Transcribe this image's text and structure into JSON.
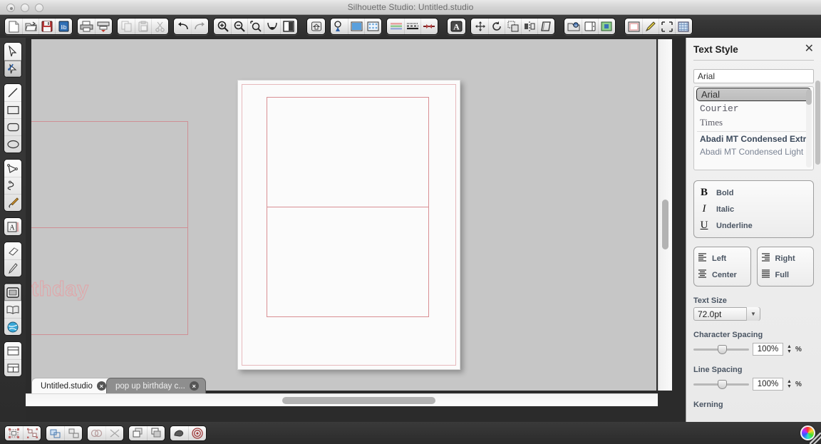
{
  "window": {
    "title": "Silhouette Studio: Untitled.studio",
    "controls": [
      "close",
      "minimize",
      "zoom"
    ]
  },
  "toolbar": {
    "groups": [
      {
        "name": "file",
        "buttons": [
          {
            "label": "New",
            "icon": "new-document-icon"
          },
          {
            "label": "Open",
            "icon": "open-folder-icon"
          },
          {
            "label": "Save",
            "icon": "save-disk-icon"
          },
          {
            "label": "Save to Library",
            "icon": "library-save-icon"
          }
        ]
      },
      {
        "name": "print",
        "buttons": [
          {
            "label": "Print",
            "icon": "printer-icon"
          },
          {
            "label": "Cut / Send",
            "icon": "cutter-icon"
          }
        ]
      },
      {
        "name": "clipboard",
        "buttons": [
          {
            "label": "Copy",
            "icon": "copy-icon"
          },
          {
            "label": "Paste",
            "icon": "paste-icon"
          },
          {
            "label": "Cut",
            "icon": "scissors-icon"
          }
        ]
      },
      {
        "name": "history",
        "buttons": [
          {
            "label": "Undo",
            "icon": "undo-arrow-icon"
          },
          {
            "label": "Redo",
            "icon": "redo-arrow-icon"
          }
        ]
      },
      {
        "name": "zoom",
        "buttons": [
          {
            "label": "Zoom In",
            "icon": "zoom-in-icon"
          },
          {
            "label": "Zoom Out",
            "icon": "zoom-out-icon"
          },
          {
            "label": "Zoom Selection",
            "icon": "zoom-selection-icon"
          },
          {
            "label": "Fit to Page",
            "icon": "fit-page-icon"
          },
          {
            "label": "Fit to Window",
            "icon": "fit-window-icon"
          }
        ]
      },
      {
        "name": "page-setup",
        "buttons": [
          {
            "label": "Page Setup",
            "icon": "house-page-icon"
          }
        ]
      },
      {
        "name": "design",
        "buttons": [
          {
            "label": "Cut Settings",
            "icon": "cut-settings-icon"
          },
          {
            "label": "Page Color",
            "icon": "page-color-icon"
          },
          {
            "label": "Registration Marks",
            "icon": "registration-marks-icon"
          }
        ]
      },
      {
        "name": "style",
        "buttons": [
          {
            "label": "Fill Color",
            "icon": "fill-color-icon"
          },
          {
            "label": "Line Style",
            "icon": "line-style-icon"
          },
          {
            "label": "Line Thickness",
            "icon": "line-thickness-icon"
          }
        ]
      },
      {
        "name": "text",
        "buttons": [
          {
            "label": "Text Style",
            "icon": "text-style-a-icon"
          }
        ]
      },
      {
        "name": "transform",
        "buttons": [
          {
            "label": "Move",
            "icon": "move-arrows-icon"
          },
          {
            "label": "Rotate",
            "icon": "rotate-icon"
          },
          {
            "label": "Scale",
            "icon": "scale-icon"
          },
          {
            "label": "Mirror",
            "icon": "mirror-icon"
          },
          {
            "label": "Shear",
            "icon": "shear-icon"
          }
        ]
      },
      {
        "name": "library",
        "buttons": [
          {
            "label": "My Library",
            "icon": "library-folder-icon"
          },
          {
            "label": "Store",
            "icon": "store-icon"
          },
          {
            "label": "Design Page",
            "icon": "design-page-icon"
          }
        ]
      },
      {
        "name": "view",
        "buttons": [
          {
            "label": "Page View",
            "icon": "page-view-icon"
          },
          {
            "label": "Trace",
            "icon": "pencil-trace-icon"
          },
          {
            "label": "Crop",
            "icon": "crop-icon"
          },
          {
            "label": "Grid",
            "icon": "grid-icon"
          }
        ]
      }
    ]
  },
  "left_tools": {
    "groups": [
      {
        "name": "select",
        "tools": [
          {
            "label": "Select",
            "icon": "cursor-arrow-icon",
            "selected": false
          },
          {
            "label": "Edit Points",
            "icon": "edit-points-icon",
            "selected": true
          }
        ]
      },
      {
        "name": "draw",
        "tools": [
          {
            "label": "Line",
            "icon": "line-icon",
            "selected": false
          },
          {
            "label": "Rectangle",
            "icon": "rectangle-icon",
            "selected": false
          },
          {
            "label": "Rounded Rectangle",
            "icon": "rounded-rectangle-icon",
            "selected": false
          },
          {
            "label": "Ellipse",
            "icon": "ellipse-icon",
            "selected": false
          }
        ]
      },
      {
        "name": "paths",
        "tools": [
          {
            "label": "Polygon",
            "icon": "polygon-icon",
            "selected": false
          },
          {
            "label": "Curve",
            "icon": "curve-icon",
            "selected": false
          },
          {
            "label": "Freehand",
            "icon": "freehand-pencil-icon",
            "selected": false
          }
        ]
      },
      {
        "name": "type",
        "tools": [
          {
            "label": "Text",
            "icon": "text-tool-icon",
            "selected": false
          }
        ]
      },
      {
        "name": "erase",
        "tools": [
          {
            "label": "Eraser",
            "icon": "eraser-icon",
            "selected": false
          },
          {
            "label": "Knife",
            "icon": "knife-icon",
            "selected": false
          }
        ]
      },
      {
        "name": "panels",
        "tools": [
          {
            "label": "Design Page",
            "icon": "design-window-icon",
            "selected": true
          },
          {
            "label": "Library",
            "icon": "open-book-icon",
            "selected": false
          },
          {
            "label": "Store",
            "icon": "globe-store-icon",
            "selected": false
          }
        ]
      },
      {
        "name": "layout",
        "tools": [
          {
            "label": "Page Layout",
            "icon": "page-layout-icon",
            "selected": false
          },
          {
            "label": "Split View",
            "icon": "split-view-icon",
            "selected": false
          }
        ]
      }
    ]
  },
  "canvas": {
    "background_color": "#c6c6c6",
    "page_color": "#fbfbfb",
    "cut_line_color": "#d98f93",
    "text_object": {
      "content": "Happy Birthday",
      "font": "Arial",
      "size_pt": "72.0pt"
    },
    "shapes": [
      {
        "name": "card-outline-left",
        "type": "rectangle"
      },
      {
        "name": "card-fold-line-left",
        "type": "line"
      },
      {
        "name": "card-outline-page",
        "type": "rectangle"
      },
      {
        "name": "card-fold-line-page",
        "type": "line"
      }
    ]
  },
  "document_tabs": [
    {
      "label": "Untitled.studio",
      "active": true,
      "close": "×"
    },
    {
      "label": "pop up birthday c...",
      "active": false,
      "close": "×"
    }
  ],
  "bottom_bar": {
    "groups": [
      {
        "name": "group-ungroup",
        "buttons": [
          {
            "label": "Group",
            "icon": "group-icon"
          },
          {
            "label": "Ungroup",
            "icon": "ungroup-icon"
          }
        ]
      },
      {
        "name": "compound",
        "buttons": [
          {
            "label": "Make Compound Path",
            "icon": "compound-path-icon"
          },
          {
            "label": "Release Compound Path",
            "icon": "release-compound-icon"
          }
        ]
      },
      {
        "name": "modify",
        "buttons": [
          {
            "label": "Weld",
            "icon": "weld-icon"
          },
          {
            "label": "Detach Lines",
            "icon": "detach-lines-icon"
          }
        ]
      },
      {
        "name": "arrange",
        "buttons": [
          {
            "label": "Bring to Front",
            "icon": "bring-front-icon"
          },
          {
            "label": "Send to Back",
            "icon": "send-back-icon"
          }
        ]
      },
      {
        "name": "effects",
        "buttons": [
          {
            "label": "Shadow",
            "icon": "shadow-icon"
          },
          {
            "label": "Offset",
            "icon": "offset-target-icon"
          }
        ]
      }
    ],
    "color_wheel": {
      "label": "Color Picker",
      "icon": "color-wheel-icon"
    }
  },
  "text_style_panel": {
    "title": "Text Style",
    "close_label": "✕",
    "font_input": {
      "value": "Arial",
      "placeholder": "Font"
    },
    "font_list": [
      {
        "name": "Arial",
        "selected": true,
        "style": "sans"
      },
      {
        "name": "Courier",
        "selected": false,
        "style": "mono"
      },
      {
        "name": "Times",
        "selected": false,
        "style": "serif"
      },
      {
        "name": "Abadi MT Condensed Extra",
        "selected": false,
        "style": "bold"
      },
      {
        "name": "Abadi MT Condensed Light",
        "selected": false,
        "style": "light"
      }
    ],
    "style_buttons": [
      {
        "glyph": "B",
        "label": "Bold",
        "active": false
      },
      {
        "glyph": "I",
        "label": "Italic",
        "active": false
      },
      {
        "glyph": "U",
        "label": "Underline",
        "active": false
      }
    ],
    "alignment": {
      "left_column": [
        {
          "label": "Left",
          "icon": "align-left-icon"
        },
        {
          "label": "Center",
          "icon": "align-center-icon"
        }
      ],
      "right_column": [
        {
          "label": "Right",
          "icon": "align-right-icon"
        },
        {
          "label": "Full",
          "icon": "align-justify-icon"
        }
      ]
    },
    "text_size": {
      "label": "Text Size",
      "value": "72.0pt"
    },
    "character_spacing": {
      "label": "Character Spacing",
      "value": "100%",
      "unit": "%",
      "slider_pct": 45
    },
    "line_spacing": {
      "label": "Line Spacing",
      "value": "100%",
      "unit": "%",
      "slider_pct": 45
    },
    "kerning": {
      "label": "Kerning"
    }
  }
}
